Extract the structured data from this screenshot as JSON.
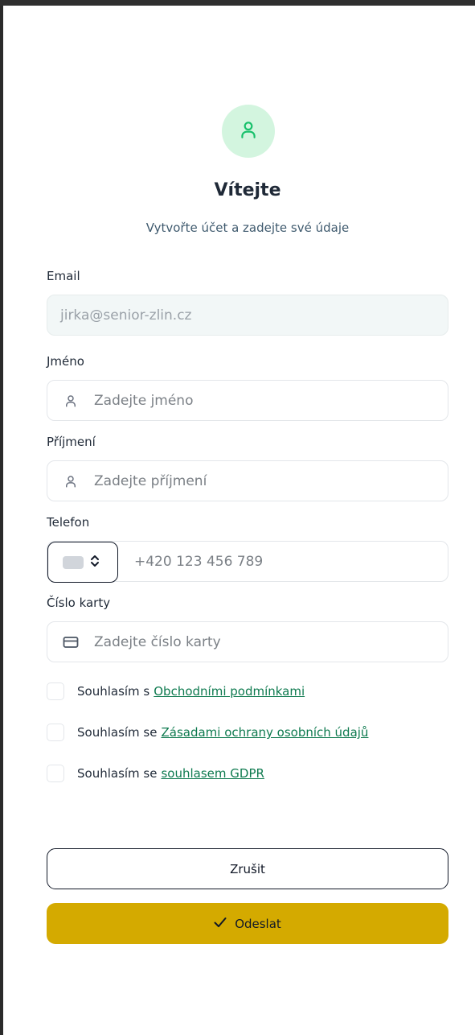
{
  "header": {
    "avatar_icon": "user-icon",
    "title": "Vítejte",
    "subtitle": "Vytvořte účet a zadejte své údaje"
  },
  "form": {
    "email": {
      "label": "Email",
      "value": "jirka@senior-zlin.cz"
    },
    "first_name": {
      "label": "Jméno",
      "placeholder": "Zadejte jméno",
      "icon": "user-icon"
    },
    "last_name": {
      "label": "Příjmení",
      "placeholder": "Zadejte příjmení",
      "icon": "user-icon"
    },
    "phone": {
      "label": "Telefon",
      "placeholder": "+420 123 456 789",
      "country_icon": "flag-icon"
    },
    "card": {
      "label": "Číslo karty",
      "placeholder": "Zadejte číslo karty",
      "icon": "credit-card-icon"
    }
  },
  "consents": [
    {
      "text": "Souhlasím s",
      "link": "Obchodními podmínkami"
    },
    {
      "text": "Souhlasím se",
      "link": "Zásadami ochrany osobních údajů"
    },
    {
      "text": "Souhlasím se",
      "link": "souhlasem GDPR"
    }
  ],
  "actions": {
    "cancel_label": "Zrušit",
    "submit_label": "Odeslat"
  },
  "colors": {
    "accent": "#d4aa00",
    "avatar_bg": "#d3f5df",
    "avatar_fg": "#16c06a",
    "link": "#0e7a4f"
  }
}
